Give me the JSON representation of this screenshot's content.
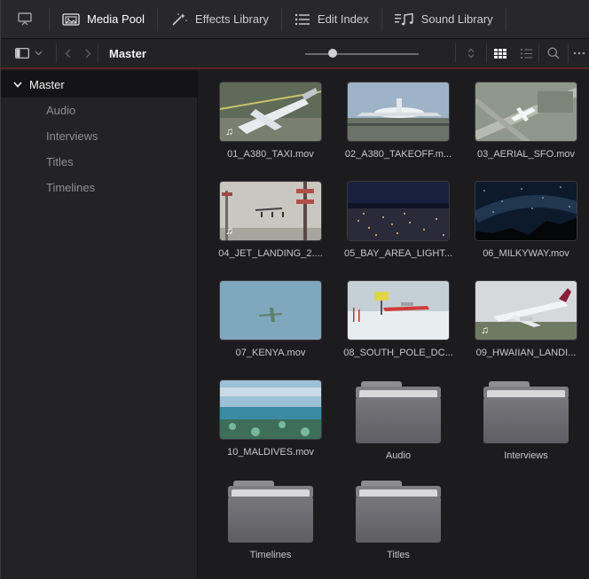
{
  "topbar": {
    "tabs": [
      {
        "label": "",
        "icon": "monitor-icon"
      },
      {
        "label": "Media Pool",
        "icon": "media-pool-icon",
        "active": true
      },
      {
        "label": "Effects Library",
        "icon": "magic-wand-icon"
      },
      {
        "label": "Edit Index",
        "icon": "list-icon"
      },
      {
        "label": "Sound Library",
        "icon": "music-note-icon"
      }
    ]
  },
  "toolbar": {
    "breadcrumb": "Master",
    "zoom_slider_value": 0.2
  },
  "sidebar": {
    "root_label": "Master",
    "items": [
      {
        "label": "Audio"
      },
      {
        "label": "Interviews"
      },
      {
        "label": "Titles"
      },
      {
        "label": "Timelines"
      }
    ]
  },
  "clips": [
    {
      "name": "01_A380_TAXI.mov",
      "audio": true
    },
    {
      "name": "02_A380_TAKEOFF.m...",
      "audio": false
    },
    {
      "name": "03_AERIAL_SFO.mov",
      "audio": false
    },
    {
      "name": "04_JET_LANDING_2....",
      "audio": true
    },
    {
      "name": "05_BAY_AREA_LIGHT...",
      "audio": false
    },
    {
      "name": "06_MILKYWAY.mov",
      "audio": false
    },
    {
      "name": "07_KENYA.mov",
      "audio": false
    },
    {
      "name": "08_SOUTH_POLE_DC...",
      "audio": false
    },
    {
      "name": "09_HWAIIAN_LANDI...",
      "audio": true
    },
    {
      "name": "10_MALDIVES.mov",
      "audio": false
    }
  ],
  "folders": [
    {
      "name": "Audio"
    },
    {
      "name": "Interviews"
    },
    {
      "name": "Timelines"
    },
    {
      "name": "Titles"
    }
  ],
  "colors": {
    "accent_red": "#5c2326",
    "background": "#1c1c1e",
    "sidebar": "#232326"
  }
}
